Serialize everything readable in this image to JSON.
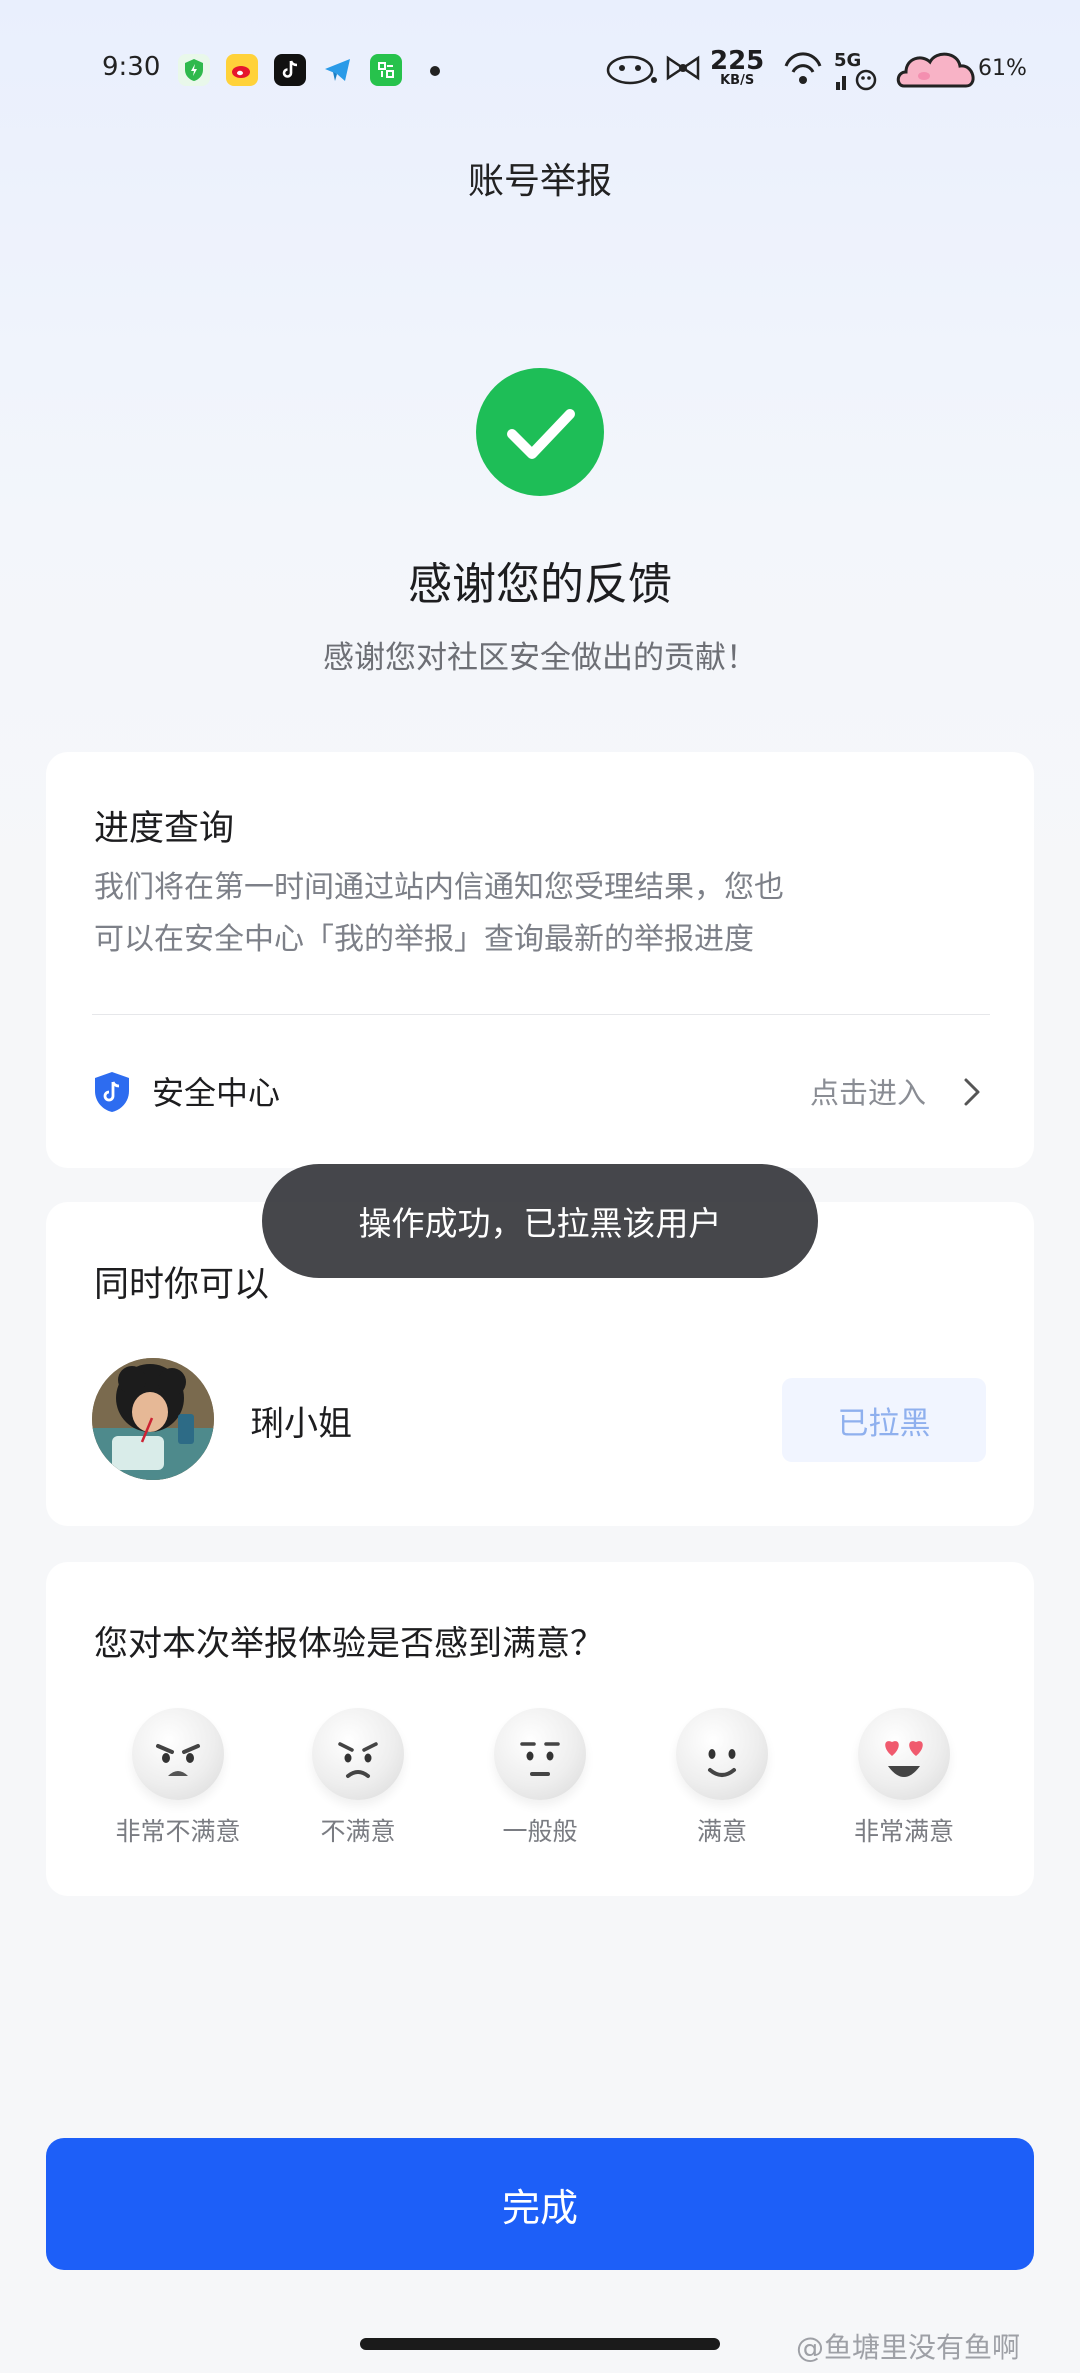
{
  "status_bar": {
    "time": "9:30",
    "net_speed_value": "225",
    "net_speed_unit": "KB/S",
    "network": "5G",
    "battery": "61%",
    "apps": [
      "security-app-icon",
      "weibo-icon",
      "tiktok-icon",
      "telegram-icon",
      "calculator-icon"
    ]
  },
  "page": {
    "title": "账号举报"
  },
  "result": {
    "heading": "感谢您的反馈",
    "subheading": "感谢您对社区安全做出的贡献！",
    "accent": "#1ebe57"
  },
  "progress_card": {
    "title": "进度查询",
    "desc_line1": "我们将在第一时间通过站内信通知您受理结果，您也",
    "desc_line2": "可以在安全中心「我的举报」查询最新的举报进度",
    "security_center_label": "安全中心",
    "enter_label": "点击进入"
  },
  "also_card": {
    "title": "同时你可以",
    "user_name": "琍小姐",
    "blocked_label": "已拉黑"
  },
  "toast": {
    "text": "操作成功，已拉黑该用户"
  },
  "survey": {
    "question": "您对本次举报体验是否感到满意？",
    "options": [
      "非常不满意",
      "不满意",
      "一般般",
      "满意",
      "非常满意"
    ]
  },
  "done_button": {
    "label": "完成",
    "color": "#1d5ff8"
  },
  "watermark": "@鱼塘里没有鱼啊"
}
